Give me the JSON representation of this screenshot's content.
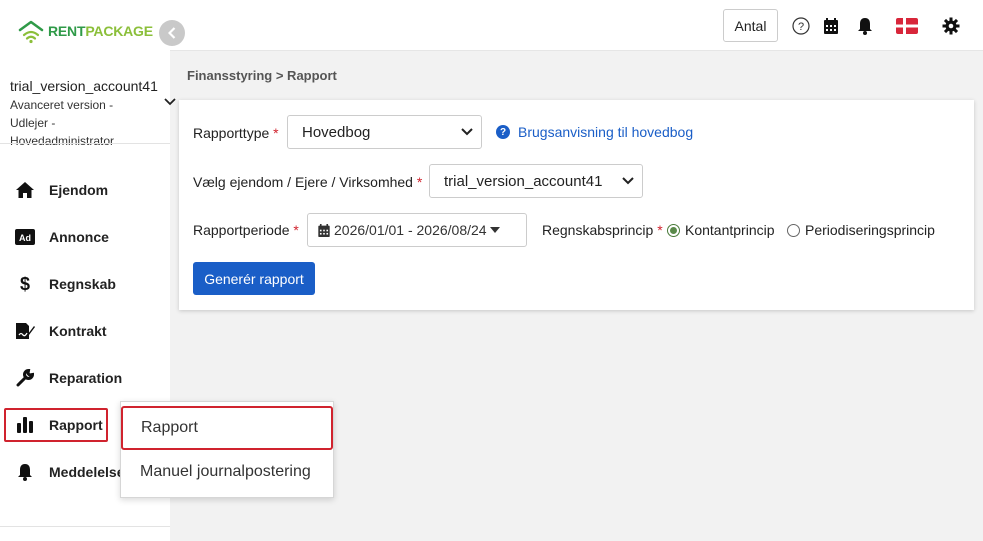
{
  "logo": {
    "part1": "RENT",
    "part2": "PACKAGE"
  },
  "account": {
    "name": "trial_version_account41",
    "description": "Avanceret version - Udlejer - Hovedadministrator"
  },
  "sidebar": {
    "items": [
      {
        "label": "Ejendom",
        "icon": "home-icon"
      },
      {
        "label": "Annonce",
        "icon": "ad-icon"
      },
      {
        "label": "Regnskab",
        "icon": "dollar-icon"
      },
      {
        "label": "Kontrakt",
        "icon": "contract-icon"
      },
      {
        "label": "Reparation",
        "icon": "wrench-icon"
      },
      {
        "label": "Rapport",
        "icon": "bar-chart-icon"
      },
      {
        "label": "Meddelelse",
        "icon": "bell-icon"
      }
    ]
  },
  "topbar": {
    "antal_label": "Antal",
    "icons": [
      "help-icon",
      "calendar-icon",
      "bell-icon",
      "danish-flag-icon",
      "gear-icon"
    ]
  },
  "breadcrumb": "Finansstyring > Rapport",
  "form": {
    "rapporttype_label": "Rapporttype",
    "rapporttype_value": "Hovedbog",
    "help_link": "Brugsanvisning til hovedbog",
    "property_label": "Vælg ejendom / Ejere / Virksomhed",
    "property_value": "trial_version_account41",
    "period_label": "Rapportperiode",
    "period_value": "2026/01/01 - 2026/08/24",
    "principle_label": "Regnskabsprincip",
    "principle_options": [
      {
        "label": "Kontantprincip",
        "checked": true
      },
      {
        "label": "Periodiseringsprincip",
        "checked": false
      }
    ],
    "required_marker": "*",
    "generate_button": "Generér rapport"
  },
  "dropdown": {
    "items": [
      {
        "label": "Rapport",
        "active": true
      },
      {
        "label": "Manuel journalpostering",
        "active": false
      }
    ]
  },
  "colors": {
    "primary": "#1a5ec7",
    "required": "#d0232e",
    "highlight": "#d0232e",
    "logo_green": "#2f9a48",
    "logo_light_green": "#8bbf3a"
  }
}
